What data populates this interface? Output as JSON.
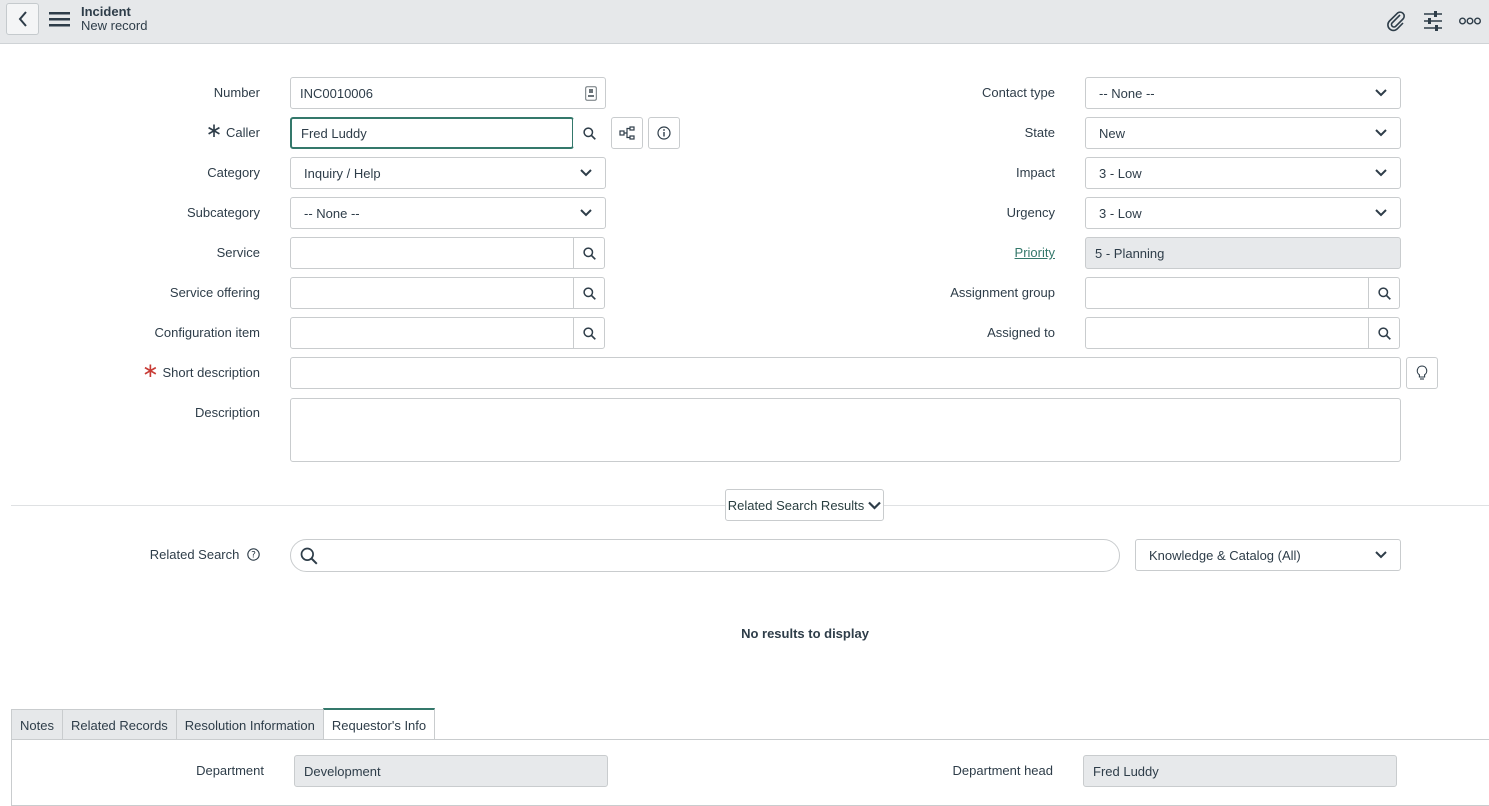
{
  "header": {
    "title": "Incident",
    "subtitle": "New record"
  },
  "form": {
    "number": {
      "label": "Number",
      "value": "INC0010006"
    },
    "caller": {
      "label": "Caller",
      "value": "Fred Luddy"
    },
    "category": {
      "label": "Category",
      "value": "Inquiry / Help"
    },
    "subcategory": {
      "label": "Subcategory",
      "value": "-- None --"
    },
    "service": {
      "label": "Service",
      "value": ""
    },
    "service_offering": {
      "label": "Service offering",
      "value": ""
    },
    "configuration_item": {
      "label": "Configuration item",
      "value": ""
    },
    "short_description": {
      "label": "Short description",
      "value": ""
    },
    "description": {
      "label": "Description",
      "value": ""
    },
    "contact_type": {
      "label": "Contact type",
      "value": "-- None --"
    },
    "state": {
      "label": "State",
      "value": "New"
    },
    "impact": {
      "label": "Impact",
      "value": "3 - Low"
    },
    "urgency": {
      "label": "Urgency",
      "value": "3 - Low"
    },
    "priority": {
      "label": "Priority",
      "value": "5 - Planning"
    },
    "assignment_group": {
      "label": "Assignment group",
      "value": ""
    },
    "assigned_to": {
      "label": "Assigned to",
      "value": ""
    }
  },
  "related": {
    "toggle_label": "Related Search Results",
    "search_label": "Related Search",
    "search_value": "",
    "scope": "Knowledge & Catalog (All)",
    "empty_text": "No results to display"
  },
  "tabs": [
    {
      "label": "Notes"
    },
    {
      "label": "Related Records"
    },
    {
      "label": "Resolution Information"
    },
    {
      "label": "Requestor's Info"
    }
  ],
  "requestor": {
    "department": {
      "label": "Department",
      "value": "Development"
    },
    "department_head": {
      "label": "Department head",
      "value": "Fred Luddy"
    }
  },
  "colors": {
    "accent": "#34786b",
    "required": "#c83c36",
    "header_bg": "#e6e8ea"
  }
}
